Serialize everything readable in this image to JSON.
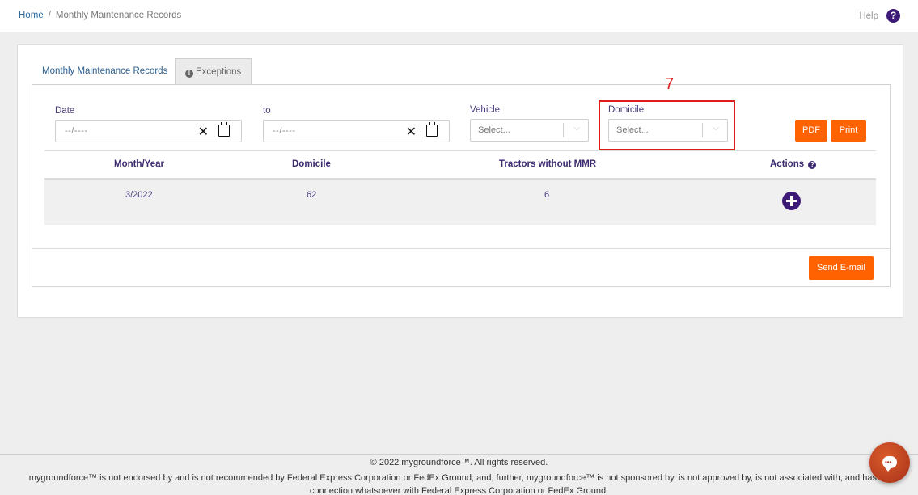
{
  "breadcrumb": {
    "home": "Home",
    "separator": "/",
    "current": "Monthly Maintenance Records"
  },
  "header": {
    "help_label": "Help",
    "help_icon": "?"
  },
  "tabs": [
    {
      "label": "Monthly Maintenance Records"
    },
    {
      "label": "Exceptions",
      "icon": "!"
    }
  ],
  "filters": {
    "date_label": "Date",
    "date_value": "--/----",
    "to_label": "to",
    "to_value": "--/----",
    "clear_glyph": "✕",
    "vehicle_label": "Vehicle",
    "vehicle_placeholder": "Select...",
    "domicile_label": "Domicile",
    "domicile_placeholder": "Select...",
    "chevron": "⌵"
  },
  "annotation": {
    "number": "7",
    "color": "#e01b1b"
  },
  "buttons": {
    "pdf": "PDF",
    "print": "Print",
    "send_email": "Send E-mail"
  },
  "table": {
    "headers": [
      "Month/Year",
      "Domicile",
      "Tractors without MMR",
      "Actions"
    ],
    "actions_help": "?",
    "rows": [
      {
        "month_year": "3/2022",
        "domicile": "62",
        "tractors_without_mmr": "6"
      }
    ]
  },
  "footer": {
    "copyright": "© 2022 mygroundforce™. All rights reserved.",
    "disclaimer": "mygroundforce™ is not endorsed by and is not recommended by Federal Express Corporation or FedEx Ground; and, further, mygroundforce™ is not sponsored by, is not approved by, is not associated with, and has no connection whatsoever with Federal Express Corporation or FedEx Ground."
  },
  "colors": {
    "accent_orange": "#ff6200",
    "brand_purple": "#3d1a78",
    "link_blue": "#2b6aa0"
  }
}
